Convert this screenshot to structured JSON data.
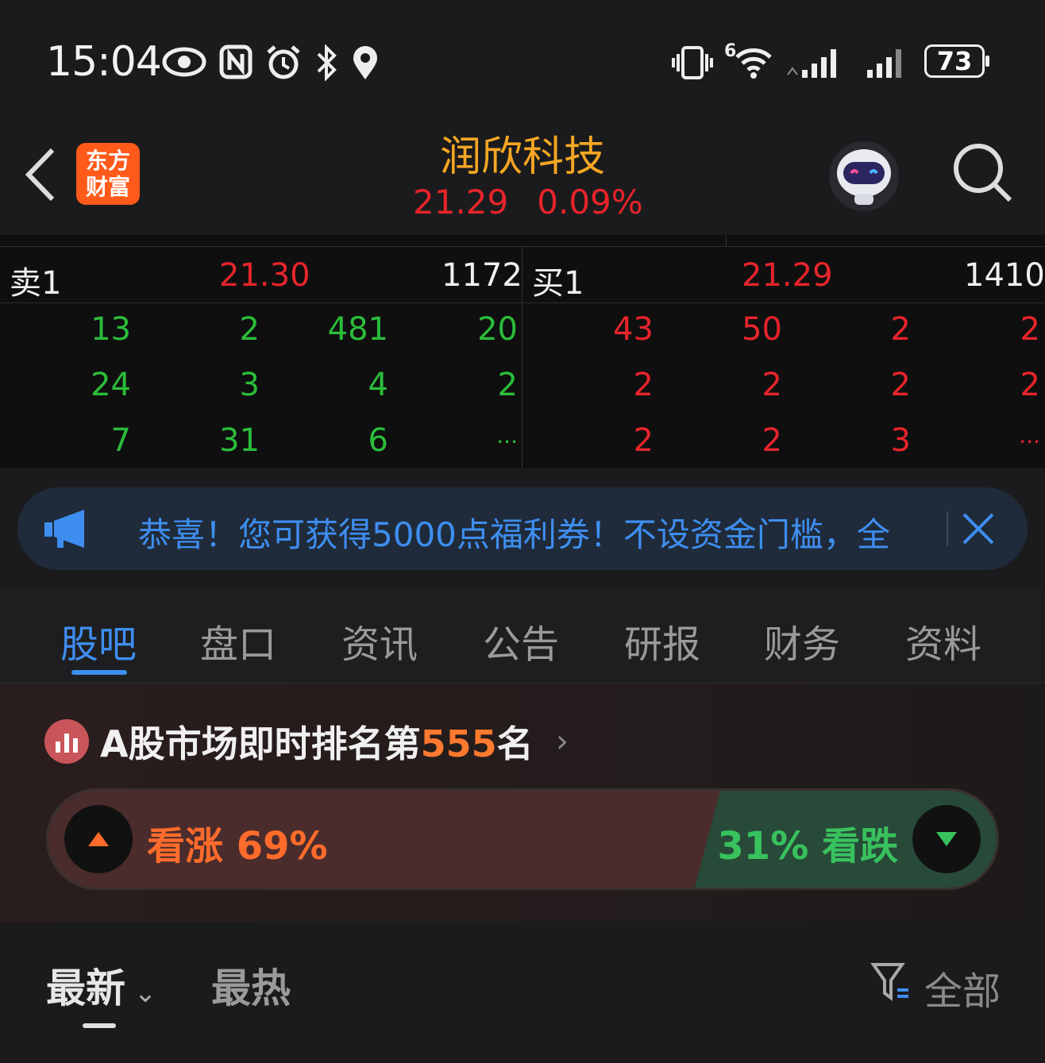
{
  "status_bar": {
    "time": "15:04",
    "battery": "73",
    "network_label": "6"
  },
  "header": {
    "logo_line1": "东方",
    "logo_line2": "财富",
    "stock_name": "润欣科技",
    "price": "21.29",
    "change_pct": "0.09%"
  },
  "order_book": {
    "sell_label": "卖1",
    "sell_price": "21.30",
    "sell_volume": "1172",
    "buy_label": "买1",
    "buy_price": "21.29",
    "buy_volume": "1410",
    "sell_queue": [
      [
        "13",
        "2",
        "481",
        "20"
      ],
      [
        "24",
        "3",
        "4",
        "2"
      ],
      [
        "7",
        "31",
        "6",
        "..."
      ]
    ],
    "buy_queue": [
      [
        "43",
        "50",
        "2",
        "2"
      ],
      [
        "2",
        "2",
        "2",
        "2"
      ],
      [
        "2",
        "2",
        "3",
        "..."
      ]
    ]
  },
  "banner": {
    "text": "恭喜！您可获得5000点福利券！不设资金门槛，全"
  },
  "tabs": [
    {
      "label": "股吧"
    },
    {
      "label": "盘口"
    },
    {
      "label": "资讯"
    },
    {
      "label": "公告"
    },
    {
      "label": "研报"
    },
    {
      "label": "财务"
    },
    {
      "label": "资料"
    }
  ],
  "rank": {
    "prefix": "A股市场即时排名第",
    "number": "555",
    "suffix": "名"
  },
  "vote": {
    "bull_label": "看涨 69%",
    "bear_label": "31% 看跌",
    "bull_pct": 69,
    "bear_pct": 31
  },
  "sort": {
    "latest": "最新",
    "hottest": "最热",
    "filter": "全部"
  },
  "colors": {
    "up": "#e8242b",
    "down": "#2bbd3a",
    "accent": "#3e8ef0",
    "title": "#f5a623"
  }
}
